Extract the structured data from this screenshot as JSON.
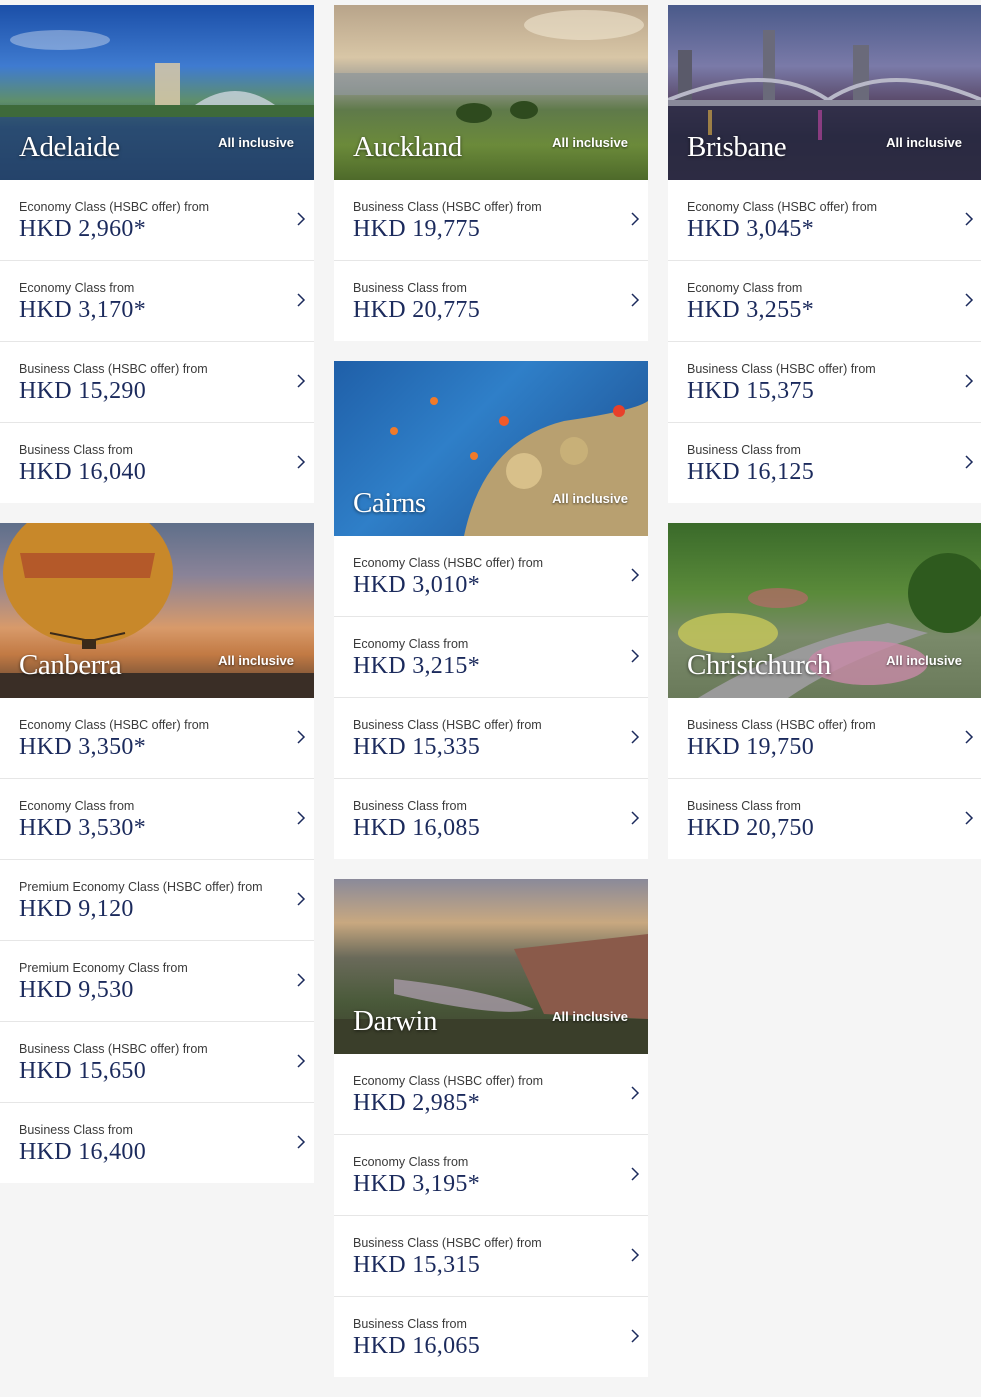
{
  "colors": {
    "price": "#1b2a5c",
    "badge": "#ffffff",
    "background": "#f5f5f5"
  },
  "cards": [
    {
      "city": "Adelaide",
      "badge": "All inclusive",
      "icon": "chevron-right-icon",
      "fares": [
        {
          "label": "Economy Class (HSBC offer) from",
          "price": "HKD 2,960*"
        },
        {
          "label": "Economy Class from",
          "price": "HKD 3,170*"
        },
        {
          "label": "Business Class (HSBC offer) from",
          "price": "HKD 15,290"
        },
        {
          "label": "Business Class from",
          "price": "HKD 16,040"
        }
      ]
    },
    {
      "city": "Auckland",
      "badge": "All inclusive",
      "icon": "chevron-right-icon",
      "fares": [
        {
          "label": "Business Class (HSBC offer) from",
          "price": "HKD 19,775"
        },
        {
          "label": "Business Class from",
          "price": "HKD 20,775"
        }
      ]
    },
    {
      "city": "Brisbane",
      "badge": "All inclusive",
      "icon": "chevron-right-icon",
      "fares": [
        {
          "label": "Economy Class (HSBC offer) from",
          "price": "HKD 3,045*"
        },
        {
          "label": "Economy Class from",
          "price": "HKD 3,255*"
        },
        {
          "label": "Business Class (HSBC offer) from",
          "price": "HKD 15,375"
        },
        {
          "label": "Business Class from",
          "price": "HKD 16,125"
        }
      ]
    },
    {
      "city": "Cairns",
      "badge": "All inclusive",
      "icon": "chevron-right-icon",
      "fares": [
        {
          "label": "Economy Class (HSBC offer) from",
          "price": "HKD 3,010*"
        },
        {
          "label": "Economy Class from",
          "price": "HKD 3,215*"
        },
        {
          "label": "Business Class (HSBC offer) from",
          "price": "HKD 15,335"
        },
        {
          "label": "Business Class from",
          "price": "HKD 16,085"
        }
      ]
    },
    {
      "city": "Canberra",
      "badge": "All inclusive",
      "icon": "chevron-right-icon",
      "fares": [
        {
          "label": "Economy Class (HSBC offer) from",
          "price": "HKD 3,350*"
        },
        {
          "label": "Economy Class from",
          "price": "HKD 3,530*"
        },
        {
          "label": "Premium Economy Class (HSBC offer) from",
          "price": "HKD 9,120"
        },
        {
          "label": "Premium Economy Class from",
          "price": "HKD 9,530"
        },
        {
          "label": "Business Class (HSBC offer) from",
          "price": "HKD 15,650"
        },
        {
          "label": "Business Class from",
          "price": "HKD 16,400"
        }
      ]
    },
    {
      "city": "Christchurch",
      "badge": "All inclusive",
      "icon": "chevron-right-icon",
      "fares": [
        {
          "label": "Business Class (HSBC offer) from",
          "price": "HKD 19,750"
        },
        {
          "label": "Business Class from",
          "price": "HKD 20,750"
        }
      ]
    },
    {
      "city": "Darwin",
      "badge": "All inclusive",
      "icon": "chevron-right-icon",
      "fares": [
        {
          "label": "Economy Class (HSBC offer) from",
          "price": "HKD 2,985*"
        },
        {
          "label": "Economy Class from",
          "price": "HKD 3,195*"
        },
        {
          "label": "Business Class (HSBC offer) from",
          "price": "HKD 15,315"
        },
        {
          "label": "Business Class from",
          "price": "HKD 16,065"
        }
      ]
    }
  ]
}
